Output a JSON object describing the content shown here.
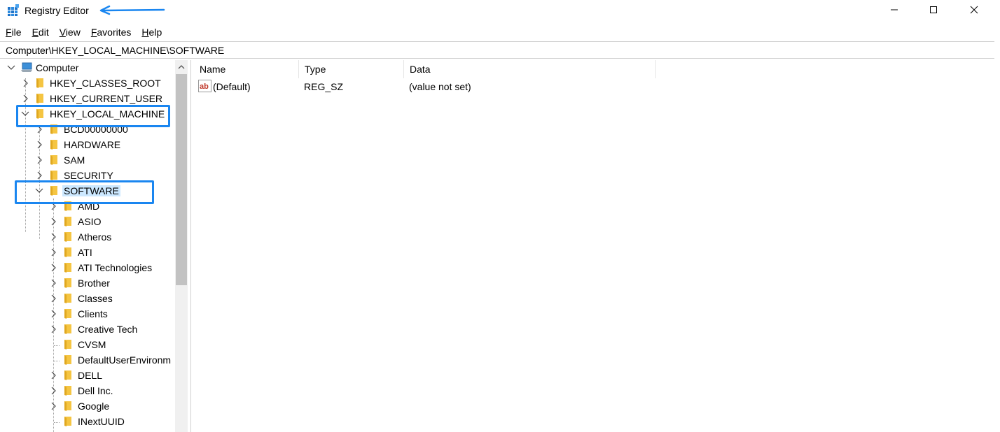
{
  "window": {
    "title": "Registry Editor",
    "icons": {
      "app": "registry-cube-icon",
      "minimize": "minimize-icon",
      "maximize": "maximize-icon",
      "close": "close-icon"
    }
  },
  "menu": [
    {
      "accel": "F",
      "rest": "ile"
    },
    {
      "accel": "E",
      "rest": "dit"
    },
    {
      "accel": "V",
      "rest": "iew"
    },
    {
      "accel": "F",
      "rest": "avorites"
    },
    {
      "accel": "H",
      "rest": "elp"
    }
  ],
  "address": {
    "path": "Computer\\HKEY_LOCAL_MACHINE\\SOFTWARE"
  },
  "tree": {
    "root": "Computer",
    "hives": {
      "classes_root": "HKEY_CLASSES_ROOT",
      "current_user": "HKEY_CURRENT_USER",
      "local_machine": "HKEY_LOCAL_MACHINE"
    },
    "hklm_children": {
      "bcd": "BCD00000000",
      "hardware": "HARDWARE",
      "sam": "SAM",
      "security": "SECURITY",
      "software": "SOFTWARE"
    },
    "software_children": [
      {
        "label": "AMD",
        "expandable": true
      },
      {
        "label": "ASIO",
        "expandable": true
      },
      {
        "label": "Atheros",
        "expandable": true
      },
      {
        "label": "ATI",
        "expandable": true
      },
      {
        "label": "ATI Technologies",
        "expandable": true
      },
      {
        "label": "Brother",
        "expandable": true
      },
      {
        "label": "Classes",
        "expandable": true
      },
      {
        "label": "Clients",
        "expandable": true
      },
      {
        "label": "Creative Tech",
        "expandable": true
      },
      {
        "label": "CVSM",
        "expandable": false
      },
      {
        "label": "DefaultUserEnvironm",
        "expandable": false
      },
      {
        "label": "DELL",
        "expandable": true
      },
      {
        "label": "Dell Inc.",
        "expandable": true
      },
      {
        "label": "Google",
        "expandable": true
      },
      {
        "label": "INextUUID",
        "expandable": false
      }
    ]
  },
  "values": {
    "columns": {
      "name": "Name",
      "type": "Type",
      "data": "Data"
    },
    "rows": [
      {
        "name": "(Default)",
        "type": "REG_SZ",
        "data": "(value not set)"
      }
    ]
  },
  "colors": {
    "highlight": "#1a86f0",
    "selection": "#cce8ff",
    "folder": "#f5c542"
  }
}
